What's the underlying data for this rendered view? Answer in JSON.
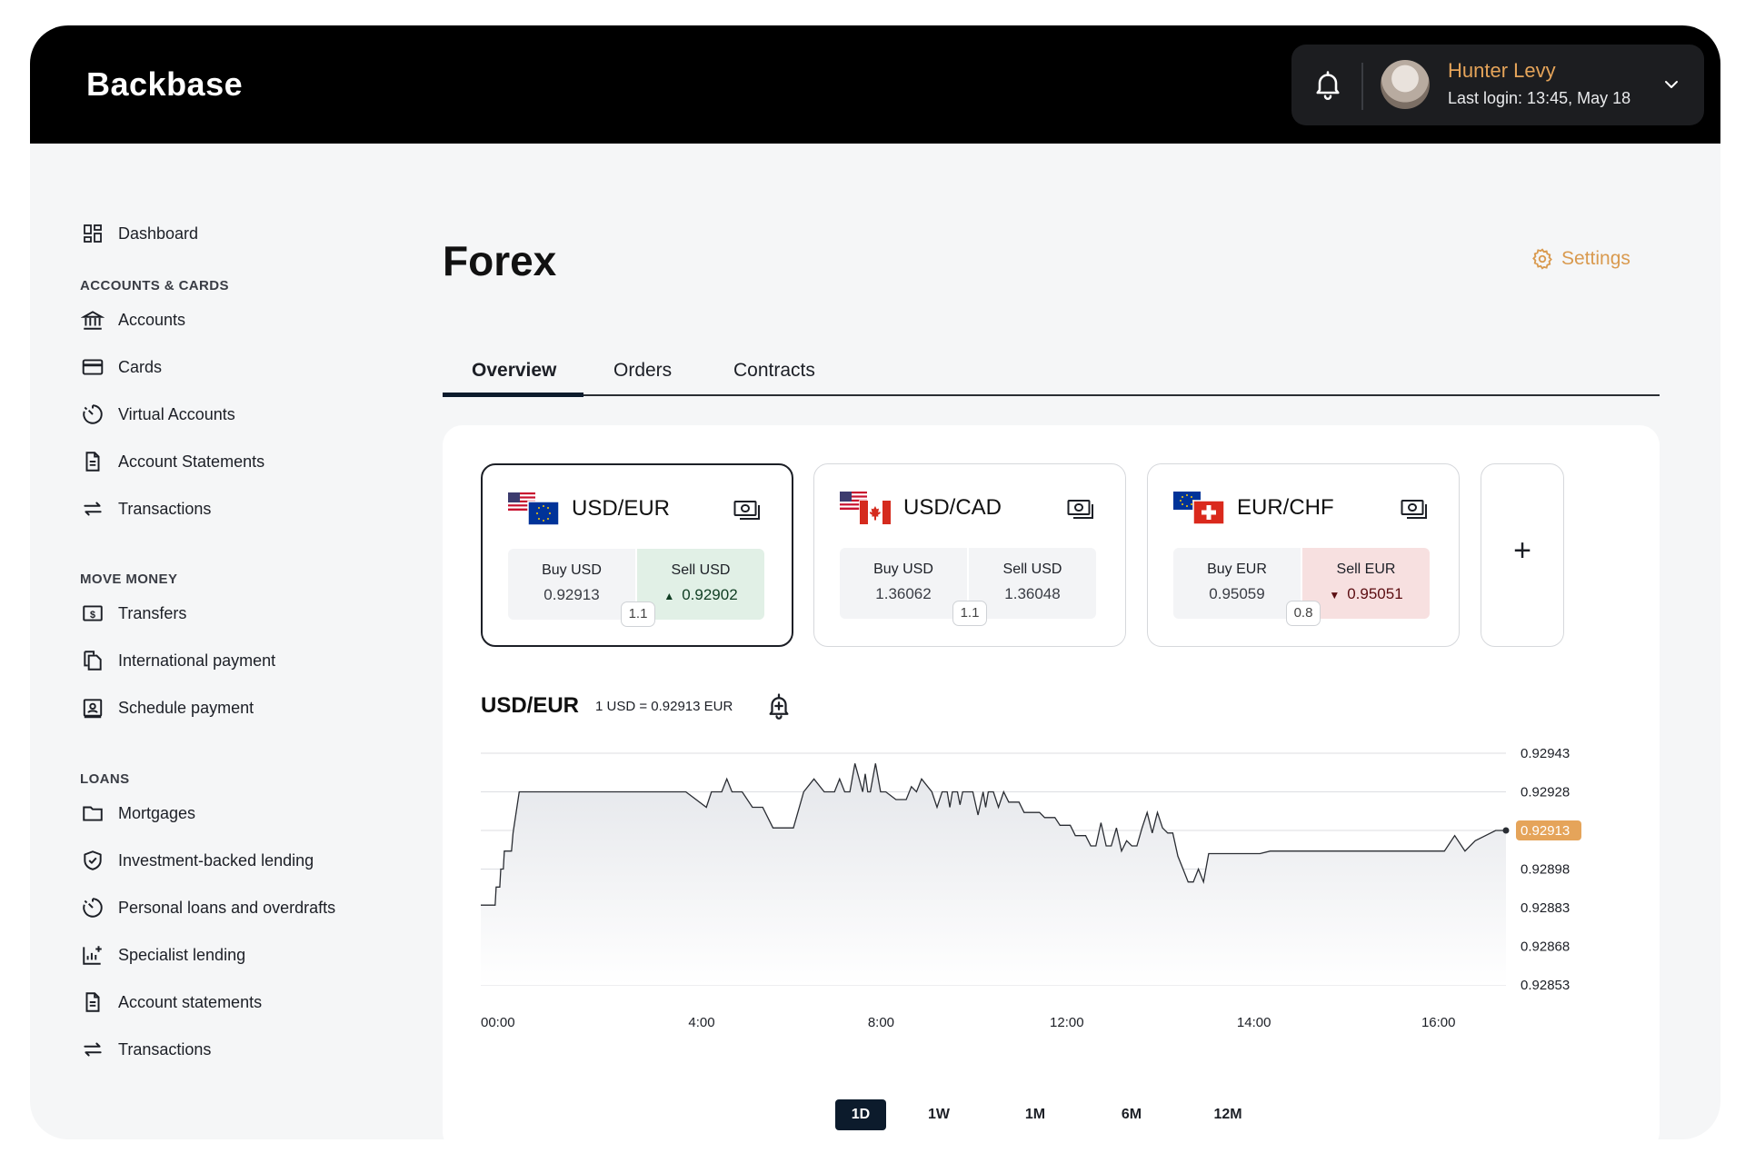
{
  "header": {
    "logo": "Backbase",
    "user_name": "Hunter Levy",
    "last_login": "Last login: 13:45, May 18"
  },
  "sidebar": {
    "dashboard": "Dashboard",
    "sections": [
      {
        "title": "ACCOUNTS & CARDS",
        "items": [
          "Accounts",
          "Cards",
          "Virtual Accounts",
          "Account Statements",
          "Transactions"
        ]
      },
      {
        "title": "MOVE MONEY",
        "items": [
          "Transfers",
          "International payment",
          "Schedule payment"
        ]
      },
      {
        "title": "LOANS",
        "items": [
          "Mortgages",
          "Investment-backed lending",
          "Personal loans and overdrafts",
          "Specialist lending",
          "Account statements",
          "Transactions"
        ]
      }
    ]
  },
  "page": {
    "title": "Forex",
    "settings_label": "Settings",
    "tabs": [
      "Overview",
      "Orders",
      "Contracts"
    ],
    "active_tab": "Overview"
  },
  "pairs": [
    {
      "name": "USD/EUR",
      "buy_label": "Buy USD",
      "buy_value": "0.92913",
      "sell_label": "Sell USD",
      "sell_value": "0.92902",
      "sell_trend": "up",
      "spread": "1.1",
      "selected": true
    },
    {
      "name": "USD/CAD",
      "buy_label": "Buy USD",
      "buy_value": "1.36062",
      "sell_label": "Sell USD",
      "sell_value": "1.36048",
      "sell_trend": "none",
      "spread": "1.1",
      "selected": false
    },
    {
      "name": "EUR/CHF",
      "buy_label": "Buy EUR",
      "buy_value": "0.95059",
      "sell_label": "Sell EUR",
      "sell_value": "0.95051",
      "sell_trend": "down",
      "spread": "0.8",
      "selected": false
    }
  ],
  "add_card_label": "+",
  "chart": {
    "pair": "USD/EUR",
    "rate_text": "1 USD = 0.92913 EUR",
    "ranges": [
      "1D",
      "1W",
      "1M",
      "6M",
      "12M"
    ],
    "active_range": "1D"
  },
  "colors": {
    "accent": "#d99a4f",
    "nav_dark": "#0c1b2c",
    "up_bg": "#e1f0e6",
    "down_bg": "#f7e0e0",
    "current_badge": "#e5a45a"
  },
  "chart_data": {
    "type": "area",
    "xlabel": "",
    "ylabel": "",
    "x_ticks": [
      "00:00",
      "4:00",
      "8:00",
      "12:00",
      "14:00",
      "16:00"
    ],
    "y_ticks": [
      "0.92943",
      "0.92928",
      "0.92913",
      "0.92898",
      "0.92883",
      "0.92868",
      "0.92853"
    ],
    "ylim": [
      0.92853,
      0.92943
    ],
    "current_value": "0.92913",
    "series": [
      {
        "x": [
          0,
          0.28,
          0.3,
          0.37,
          0.39,
          0.44,
          0.46,
          0.6,
          0.63,
          0.75,
          1.2,
          1.6,
          2.0,
          2.5,
          3.0,
          3.5,
          4.0,
          4.4,
          4.5,
          4.7,
          4.8,
          4.9,
          5.1,
          5.3,
          5.5,
          5.7,
          5.9,
          6.1,
          6.3,
          6.5,
          6.7,
          6.9,
          7.0,
          7.1,
          7.2,
          7.3,
          7.45,
          7.5,
          7.55,
          7.6,
          7.7,
          7.8,
          7.9,
          8.1,
          8.3,
          8.4,
          8.5,
          8.6,
          8.8,
          8.9,
          9.0,
          9.1,
          9.15,
          9.2,
          9.3,
          9.35,
          9.4,
          9.5,
          9.6,
          9.7,
          9.8,
          9.85,
          9.9,
          10.0,
          10.1,
          10.2,
          10.3,
          10.4,
          10.5,
          10.6,
          10.7,
          10.8,
          10.9,
          11.0,
          11.1,
          11.2,
          11.3,
          11.4,
          11.5,
          11.6,
          11.7,
          11.8,
          11.9,
          12.0,
          12.1,
          12.2,
          12.3,
          12.4,
          12.5,
          12.6,
          12.7,
          12.8,
          12.9,
          13.0,
          13.1,
          13.2,
          13.3,
          13.4,
          13.5,
          13.6,
          13.7,
          13.8,
          13.9,
          14.0,
          14.1,
          14.2,
          14.3,
          14.4,
          14.5,
          14.6,
          14.7,
          14.8,
          14.9,
          15.0,
          15.2,
          15.4,
          15.6,
          15.8,
          16.0,
          16.2,
          16.4,
          16.6,
          16.8,
          17.0,
          17.2,
          17.4,
          17.6,
          17.8,
          18.0,
          18.2,
          18.4,
          18.6,
          18.8,
          19.0,
          19.2,
          19.4,
          19.6,
          19.8,
          20.0
        ],
        "y": [
          0.92884,
          0.92884,
          0.92891,
          0.92891,
          0.92898,
          0.92898,
          0.92905,
          0.92905,
          0.92912,
          0.92928,
          0.92928,
          0.92928,
          0.92928,
          0.92928,
          0.92928,
          0.92928,
          0.92928,
          0.92922,
          0.92928,
          0.92928,
          0.92933,
          0.92928,
          0.92928,
          0.92922,
          0.92922,
          0.92914,
          0.92914,
          0.92914,
          0.92928,
          0.92933,
          0.92928,
          0.92928,
          0.92933,
          0.92928,
          0.92928,
          0.92939,
          0.92928,
          0.92935,
          0.92928,
          0.92928,
          0.92939,
          0.92928,
          0.92928,
          0.92925,
          0.92925,
          0.9293,
          0.92928,
          0.92933,
          0.92928,
          0.92922,
          0.92928,
          0.92928,
          0.92922,
          0.92928,
          0.92928,
          0.92923,
          0.92928,
          0.92928,
          0.92928,
          0.92919,
          0.92928,
          0.92922,
          0.92928,
          0.92928,
          0.92922,
          0.92928,
          0.92924,
          0.92924,
          0.92924,
          0.9292,
          0.9292,
          0.9292,
          0.9292,
          0.92918,
          0.92918,
          0.92918,
          0.92915,
          0.92915,
          0.92915,
          0.92911,
          0.92911,
          0.92911,
          0.92907,
          0.92907,
          0.92916,
          0.92907,
          0.92907,
          0.92914,
          0.92905,
          0.92909,
          0.92907,
          0.92907,
          0.92914,
          0.9292,
          0.92912,
          0.9292,
          0.92914,
          0.92912,
          0.92912,
          0.92903,
          0.92898,
          0.92893,
          0.92893,
          0.92898,
          0.92893,
          0.92904,
          0.92904,
          0.92904,
          0.92904,
          0.92904,
          0.92904,
          0.92904,
          0.92904,
          0.92904,
          0.92904,
          0.92905,
          0.92905,
          0.92905,
          0.92905,
          0.92905,
          0.92905,
          0.92905,
          0.92905,
          0.92905,
          0.92905,
          0.92905,
          0.92905,
          0.92905,
          0.92905,
          0.92905,
          0.92905,
          0.92905,
          0.92905,
          0.92911,
          0.92905,
          0.92909,
          0.92911,
          0.92913,
          0.92913
        ]
      }
    ]
  }
}
